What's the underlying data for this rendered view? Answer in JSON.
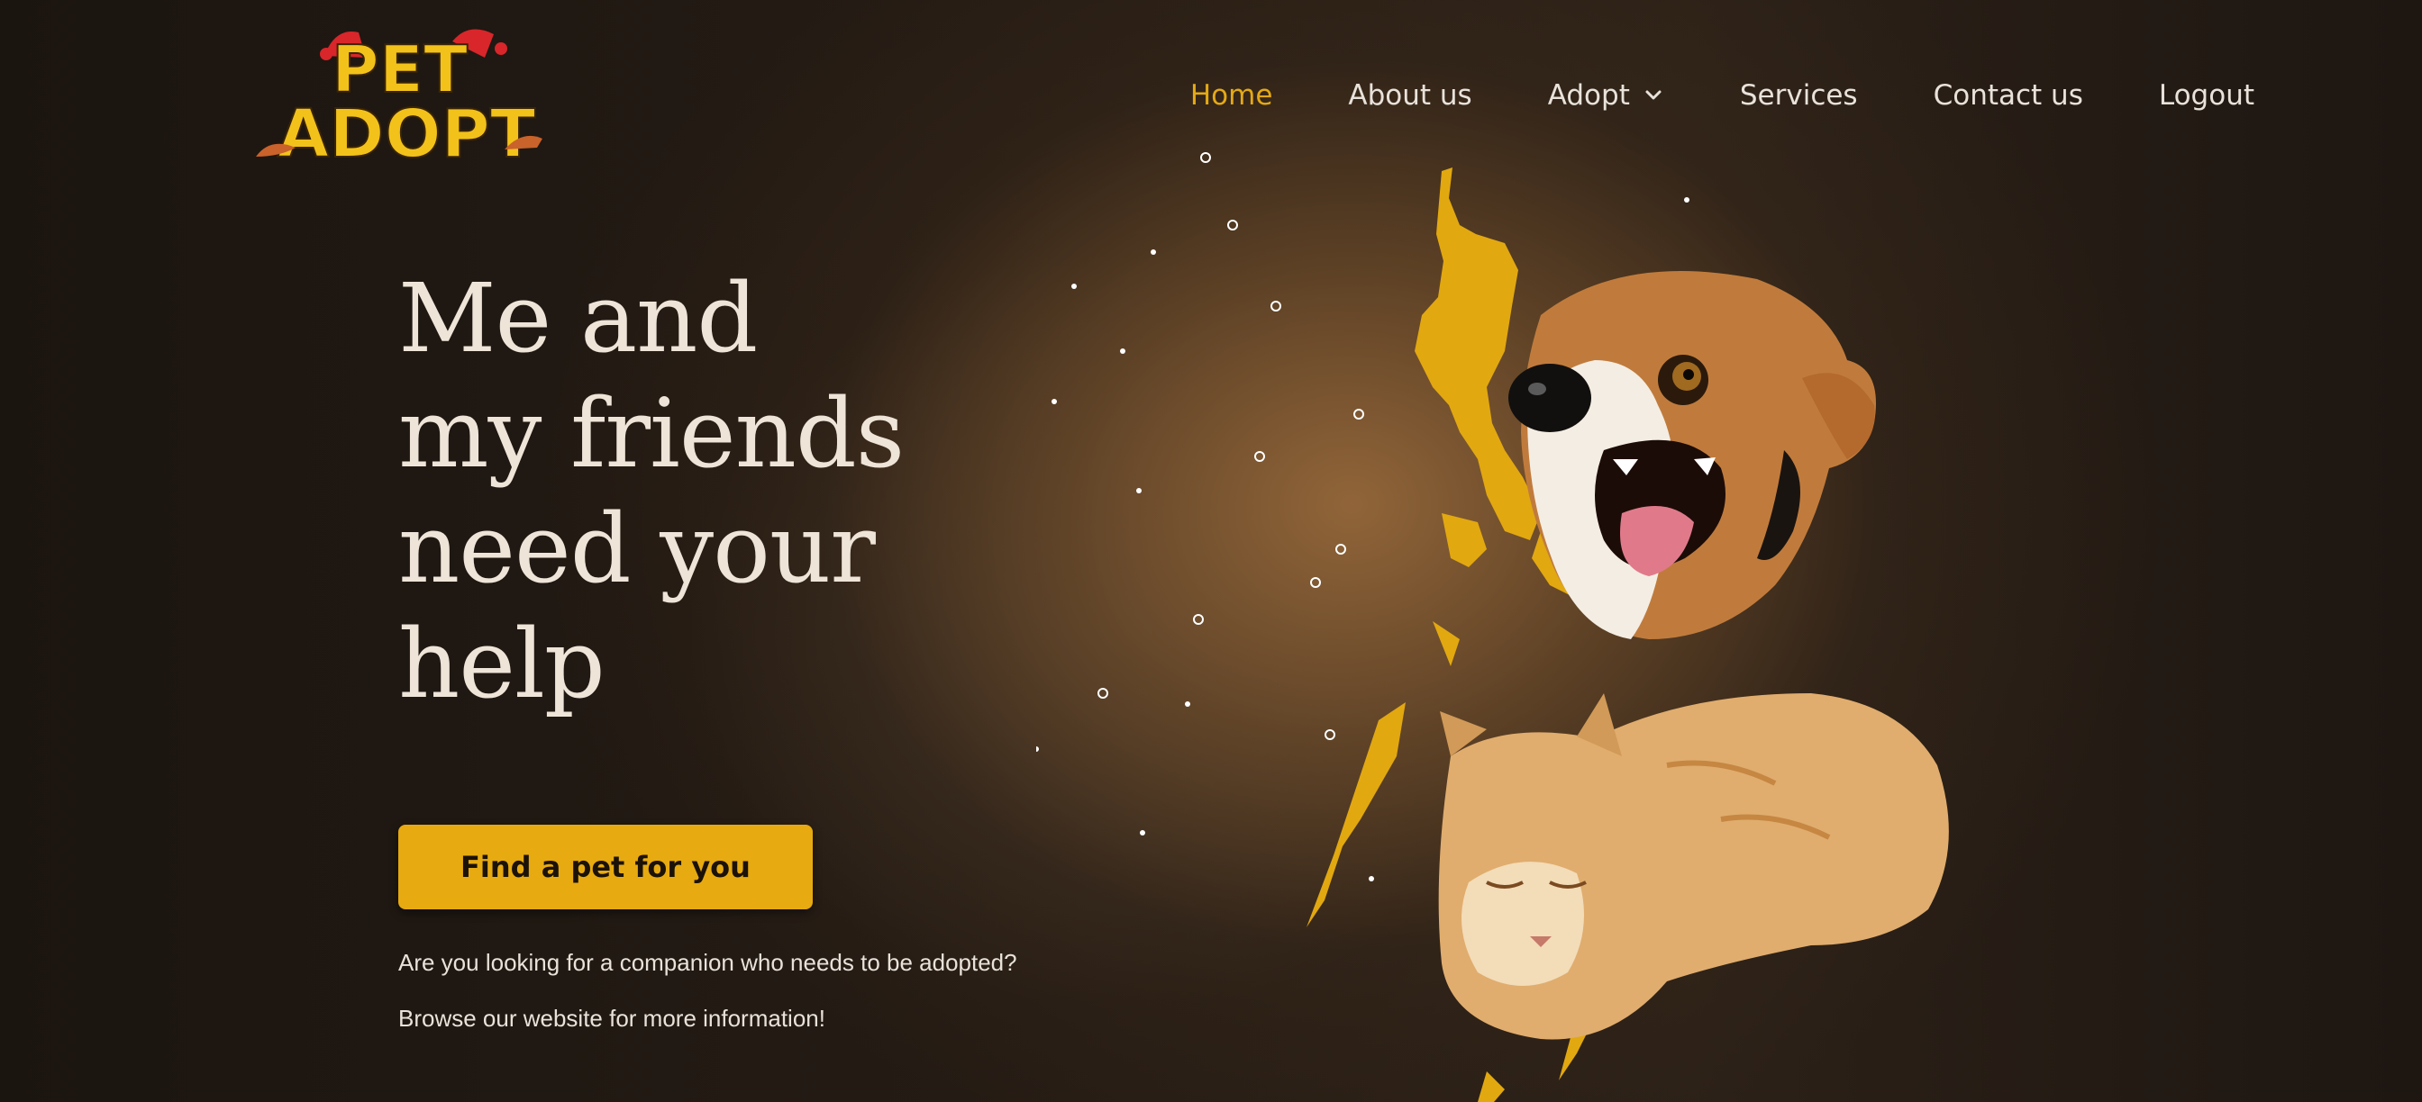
{
  "brand": {
    "logo_line1": "PET",
    "logo_line2": "ADOPT",
    "colors": {
      "accent": "#e7aa10",
      "nav_active": "#e4a915",
      "text": "#eee4d8"
    }
  },
  "nav": {
    "items": [
      {
        "label": "Home",
        "active": true
      },
      {
        "label": "About us"
      },
      {
        "label": "Adopt",
        "has_dropdown": true
      },
      {
        "label": "Services"
      },
      {
        "label": "Contact us"
      },
      {
        "label": "Logout"
      }
    ]
  },
  "hero": {
    "title_lines": [
      "Me and",
      "my friends",
      "need your",
      "help"
    ],
    "cta_label": "Find a pet for you",
    "subtext_1": "Are you looking for a companion who needs to be adopted?",
    "subtext_2": "Browse our website for more information!"
  },
  "illustration": {
    "icons": [
      "philippines-map-icon",
      "dog-illustration",
      "cat-illustration"
    ]
  }
}
